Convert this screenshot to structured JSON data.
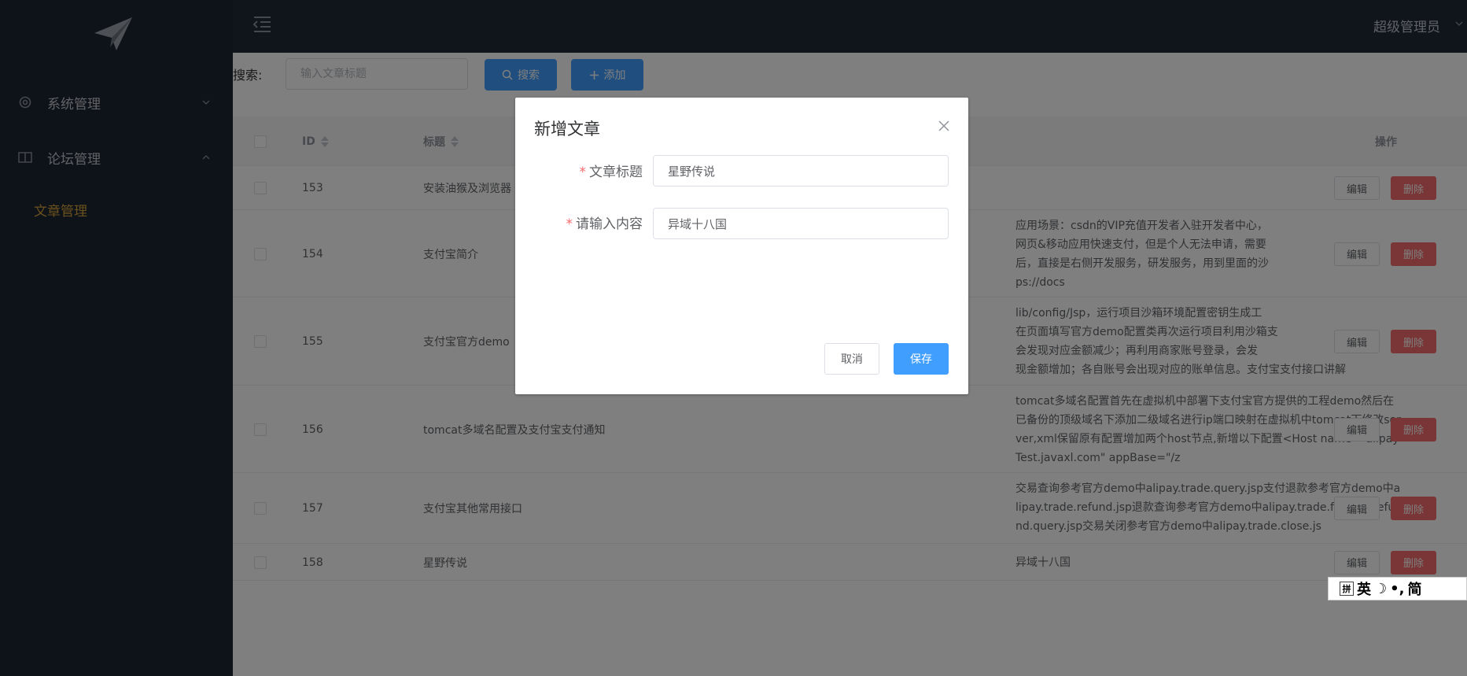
{
  "header": {
    "user": "超级管理员"
  },
  "sidebar": {
    "menus": [
      {
        "label": "系统管理",
        "icon": "gear-icon",
        "expanded": false
      },
      {
        "label": "论坛管理",
        "icon": "book-icon",
        "expanded": true
      }
    ],
    "active_submenu": "文章管理"
  },
  "toolbar": {
    "search_label": "搜索:",
    "search_placeholder": "输入文章标题",
    "search_button": "搜索",
    "add_button": "添加"
  },
  "table": {
    "headers": {
      "id": "ID",
      "title": "标题",
      "actions": "操作"
    },
    "edit_label": "编辑",
    "delete_label": "删除",
    "rows": [
      {
        "id": "153",
        "title": "安装油猴及浏览器",
        "content": ""
      },
      {
        "id": "154",
        "title": "支付宝简介",
        "content": "应用场景：csdn的VIP充值开发者入驻开发者中心，\n网页&移动应用快速支付，但是个人无法申请，需要\n后，直接是右侧开发服务，研发服务，用到里面的沙\nps://docs"
      },
      {
        "id": "155",
        "title": "支付宝官方demo",
        "content": "lib/config/Jsp，运行项目沙箱环境配置密钥生成工\n在页面填写官方demo配置类再次运行项目利用沙箱支\n会发现对应金额减少；再利用商家账号登录，会发\n现金额增加；各自账号会出现对应的账单信息。支付宝支付接口讲解"
      },
      {
        "id": "156",
        "title": "tomcat多域名配置及支付宝支付通知",
        "content": "tomcat多域名配置首先在虚拟机中部署下支付宝官方提供的工程demo然后在已备份的顶级域名下添加二级域名进行ip端口映射在虚拟机中tomcat下修改server,xml保留原有配置增加两个host节点,新增以下配置<Host name=\"alipayTest.javaxl.com\" appBase=\"/z"
      },
      {
        "id": "157",
        "title": "支付宝其他常用接口",
        "content": "交易查询参考官方demo中alipay.trade.query.jsp支付退款参考官方demo中alipay.trade.refund.jsp退款查询参考官方demo中alipay.trade.fastpay.refund.query.jsp交易关闭参考官方demo中alipay.trade.close.js"
      },
      {
        "id": "158",
        "title": "星野传说",
        "content": "异域十八国"
      }
    ]
  },
  "dialog": {
    "title": "新增文章",
    "fields": [
      {
        "label": "文章标题",
        "value": "星野传说"
      },
      {
        "label": "请输入内容",
        "value": "异域十八国"
      }
    ],
    "cancel": "取消",
    "save": "保存"
  },
  "ime": {
    "items": [
      "拼",
      "英",
      "简"
    ]
  },
  "colors": {
    "primary": "#409eff",
    "danger": "#f56c6c",
    "sidebar": "#1c2432",
    "active": "#d4a33b"
  }
}
